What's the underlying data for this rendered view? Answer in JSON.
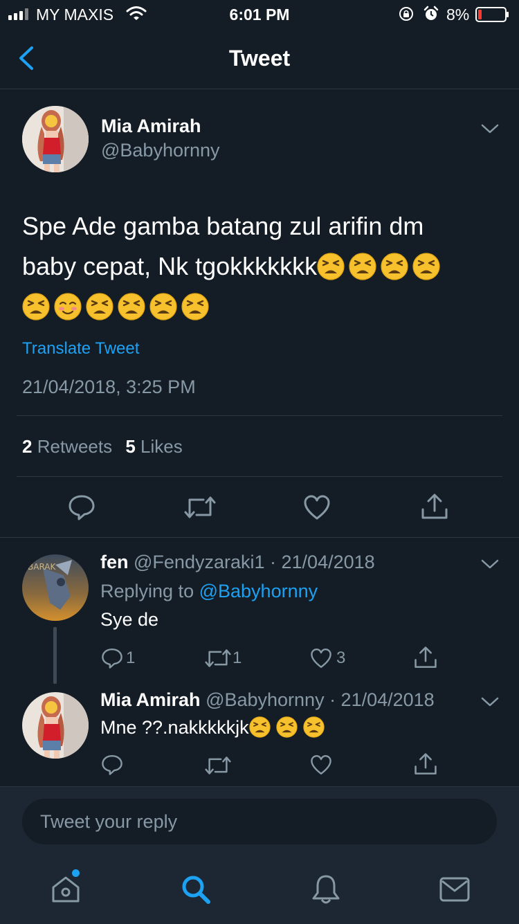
{
  "status_bar": {
    "carrier": "MY MAXIS",
    "time": "6:01 PM",
    "battery": "8%"
  },
  "nav": {
    "title": "Tweet"
  },
  "tweet": {
    "author_name": "Mia Amirah",
    "author_handle": "@Babyhornny",
    "text": "Spe Ade gamba batang zul arifin dm baby cepat, Nk tgokkkkkkk",
    "text_line1": "Spe Ade gamba batang zul arifin dm",
    "text_line2": "baby cepat, Nk tgokkkkkkk",
    "emojis_line2": [
      "tired-face-emoji",
      "tired-face-emoji",
      "tired-face-emoji",
      "tired-face-emoji"
    ],
    "emojis_line3": [
      "tired-face-emoji",
      "smiling-face-emoji",
      "tired-face-emoji",
      "tired-face-emoji",
      "tired-face-emoji",
      "tired-face-emoji"
    ],
    "translate_label": "Translate Tweet",
    "timestamp": "21/04/2018, 3:25 PM",
    "retweets_count": "2",
    "retweets_label": "Retweets",
    "likes_count": "5",
    "likes_label": "Likes"
  },
  "replies": [
    {
      "name": "fen",
      "handle_date": "@Fendyzaraki1 · 21/04/2018",
      "replying_prefix": "Replying to",
      "replying_to": "@Babyhornny",
      "text": "Sye de",
      "reply_count": "1",
      "retweet_count": "1",
      "like_count": "3"
    },
    {
      "name": "Mia Amirah",
      "handle_date": "@Babyhornny · 21/04/2018",
      "text": "Mne ??.nakkkkkjk",
      "emojis": [
        "tired-face-emoji",
        "tired-face-emoji",
        "tired-face-emoji"
      ]
    }
  ],
  "compose": {
    "placeholder": "Tweet your reply"
  },
  "tab_bar": {
    "items": [
      "home-icon",
      "search-icon",
      "notifications-icon",
      "messages-icon"
    ]
  },
  "colors": {
    "background": "#141d26",
    "accent": "#1da1f2",
    "muted": "#8899a6",
    "divider": "#2a3642"
  }
}
